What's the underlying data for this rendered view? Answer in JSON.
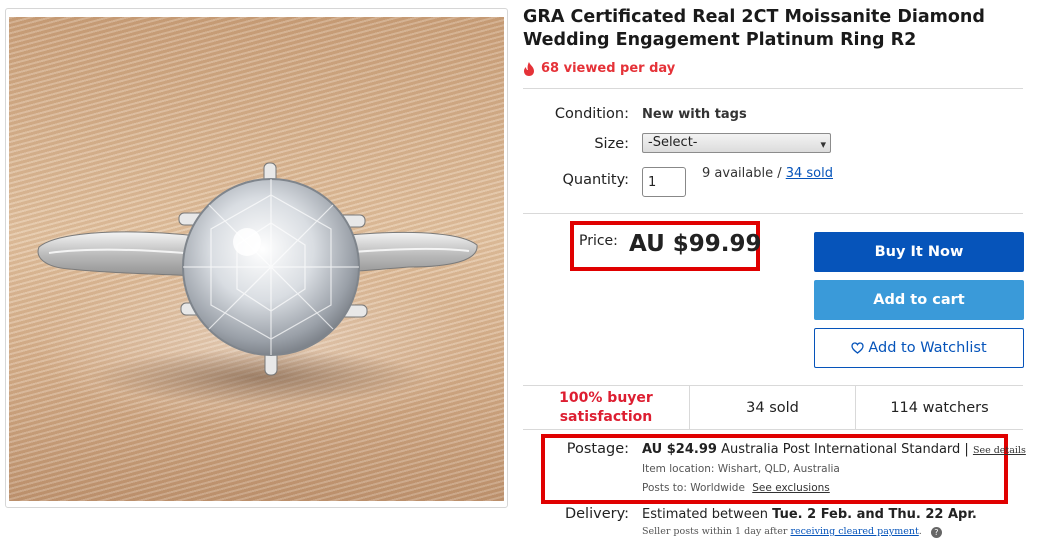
{
  "product": {
    "title": "GRA Certificated Real 2CT Moissanite Diamond Wedding Engagement Platinum Ring R2",
    "viewed": "68 viewed per day",
    "image_alt": "Moissanite diamond solitaire ring on fabric"
  },
  "details": {
    "condition_label": "Condition:",
    "condition_value": "New with tags",
    "size_label": "Size:",
    "size_selected": "-Select-",
    "quantity_label": "Quantity:",
    "quantity_value": "1",
    "available_text": "9 available /",
    "sold_link": "34 sold"
  },
  "price": {
    "label": "Price:",
    "value": "AU $99.99"
  },
  "buttons": {
    "buy_now": "Buy It Now",
    "add_to_cart": "Add to cart",
    "watchlist": "Add to Watchlist"
  },
  "stats": {
    "satisfaction_line1": "100% buyer",
    "satisfaction_line2": "satisfaction",
    "sold": "34 sold",
    "watchers": "114 watchers"
  },
  "postage": {
    "label": "Postage:",
    "cost": "AU $24.99",
    "service": "Australia Post International Standard |",
    "see_details": "See details",
    "item_location": "Item location:  Wishart, QLD, Australia",
    "posts_to": "Posts to:  Worldwide",
    "see_exclusions": "See exclusions"
  },
  "delivery": {
    "label": "Delivery:",
    "prefix": "Estimated between ",
    "range": "Tue. 2 Feb. and Thu. 22 Apr.",
    "note_prefix": "Seller posts within 1 day after ",
    "note_link": "receiving cleared payment",
    "note_suffix": "."
  },
  "colors": {
    "accent_blue": "#0654ba",
    "cart_blue": "#3a9ad9",
    "highlight_red": "#e00000",
    "satisfaction_red": "#dd1e31"
  }
}
